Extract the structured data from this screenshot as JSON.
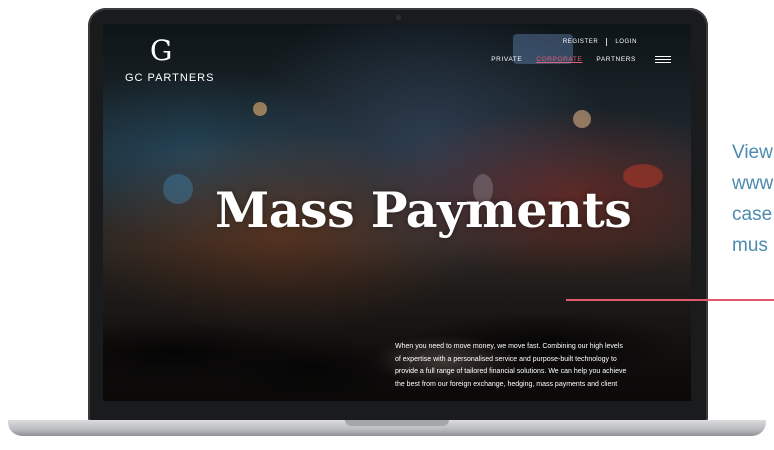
{
  "site": {
    "logo_mark": "G",
    "logo_text": "GC PARTNERS",
    "top_links": [
      "REGISTER",
      "LOGIN"
    ],
    "nav": [
      {
        "label": "PRIVATE",
        "active": false
      },
      {
        "label": "CORPORATE",
        "active": true
      },
      {
        "label": "PARTNERS",
        "active": false
      }
    ],
    "menu_icon": "hamburger-menu-icon"
  },
  "hero": {
    "title": "Mass Payments",
    "body": "When you need to move money, we move fast. Combining our high levels of expertise with a personalised service and purpose-built technology to provide a full range of tailored financial solutions. We can help you achieve the best from our foreign exchange, hedging, mass payments and client"
  },
  "annotation": {
    "lines": [
      "View",
      "www",
      "case",
      "mus"
    ],
    "line_color": "#e05a6e",
    "text_color": "#4c8ab0"
  },
  "colors": {
    "accent": "#e0607a"
  }
}
